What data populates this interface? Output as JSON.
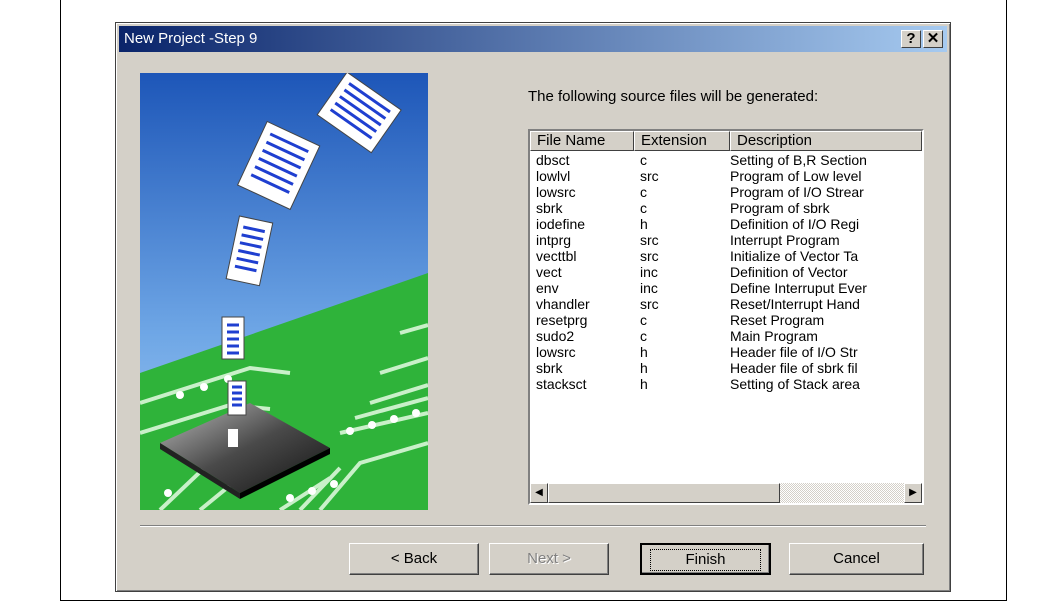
{
  "dialog": {
    "title": "New Project -Step 9",
    "help_glyph": "?",
    "close_glyph": "✕",
    "prompt": "The following source files will be generated:"
  },
  "table": {
    "columns": [
      "File Name",
      "Extension",
      "Description"
    ],
    "rows": [
      [
        "dbsct",
        "c",
        "Setting of B,R Section"
      ],
      [
        "lowlvl",
        "src",
        "Program of Low level"
      ],
      [
        "lowsrc",
        "c",
        "Program of I/O Strear"
      ],
      [
        "sbrk",
        "c",
        "Program of sbrk"
      ],
      [
        "iodefine",
        "h",
        "Definition of I/O Regi"
      ],
      [
        "intprg",
        "src",
        "Interrupt Program"
      ],
      [
        "vecttbl",
        "src",
        "Initialize of Vector Ta"
      ],
      [
        "vect",
        "inc",
        "Definition of Vector"
      ],
      [
        "env",
        "inc",
        "Define Interruput Ever"
      ],
      [
        "vhandler",
        "src",
        "Reset/Interrupt Hand"
      ],
      [
        "resetprg",
        "c",
        "Reset Program"
      ],
      [
        "sudo2",
        "c",
        "Main Program"
      ],
      [
        "lowsrc",
        "h",
        "Header file of I/O Str"
      ],
      [
        "sbrk",
        "h",
        "Header file of sbrk fil"
      ],
      [
        "stacksct",
        "h",
        "Setting of Stack area"
      ]
    ]
  },
  "scrollbar": {
    "left_arrow": "◀",
    "right_arrow": "▶",
    "position_fraction": 0.0
  },
  "buttons": {
    "back": "< Back",
    "next": "Next >",
    "finish": "Finish",
    "cancel": "Cancel"
  },
  "icons": {
    "help": "help-question-icon",
    "close": "close-icon",
    "illustration": "wizard-illustration-chip-with-documents"
  },
  "colors": {
    "titlebar_start": "#0a246a",
    "titlebar_end": "#a6caf0",
    "dialog_face": "#d4d0c8",
    "board_green": "#2fb33a",
    "sky_blue": "#2f73c8"
  }
}
